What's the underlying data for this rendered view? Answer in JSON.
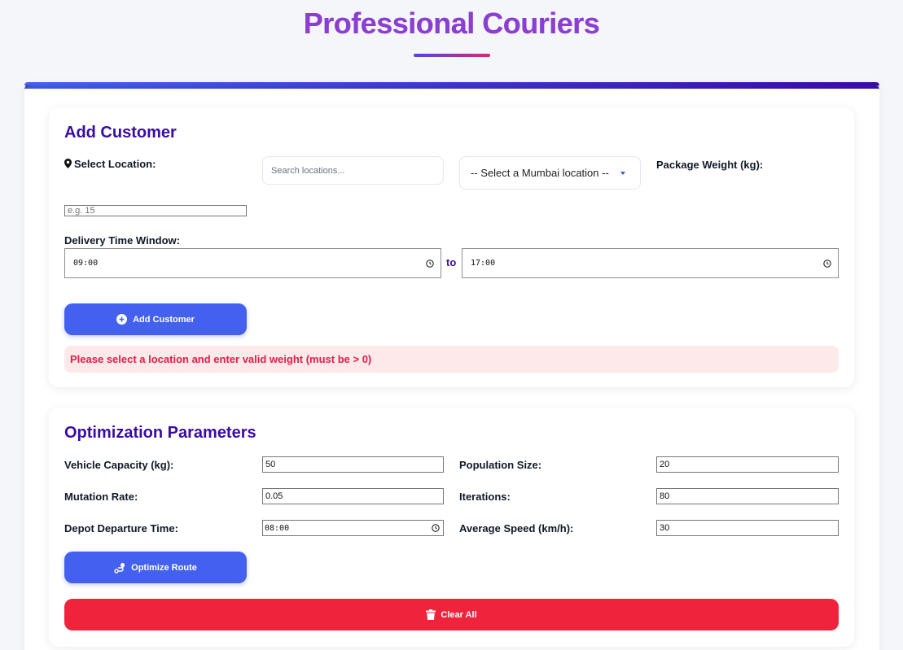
{
  "app": {
    "title": "Professional Couriers"
  },
  "add_customer": {
    "title": "Add Customer",
    "location_label": "Select Location:",
    "search_placeholder": "Search locations...",
    "location_select_value": "-- Select a Mumbai location --",
    "weight_label": "Package Weight (kg):",
    "weight_placeholder": "e.g. 15",
    "time_window_label": "Delivery Time Window:",
    "time_start": "09:00",
    "to_label": "to",
    "time_end": "17:00",
    "add_button": "Add Customer",
    "error_message": "Please select a location and enter valid weight (must be > 0)"
  },
  "params": {
    "title": "Optimization Parameters",
    "vehicle_capacity_label": "Vehicle Capacity (kg):",
    "vehicle_capacity": "50",
    "population_size_label": "Population Size:",
    "population_size": "20",
    "mutation_rate_label": "Mutation Rate:",
    "mutation_rate": "0.05",
    "iterations_label": "Iterations:",
    "iterations": "80",
    "depot_departure_label": "Depot Departure Time:",
    "depot_departure": "08:00",
    "avg_speed_label": "Average Speed (km/h):",
    "avg_speed": "30",
    "optimize_button": "Optimize Route",
    "clear_button": "Clear All"
  },
  "colors": {
    "accent": "#4361ee",
    "heading": "#3a0ca3",
    "danger": "#ef233c",
    "error_bg": "#fde8ea"
  }
}
